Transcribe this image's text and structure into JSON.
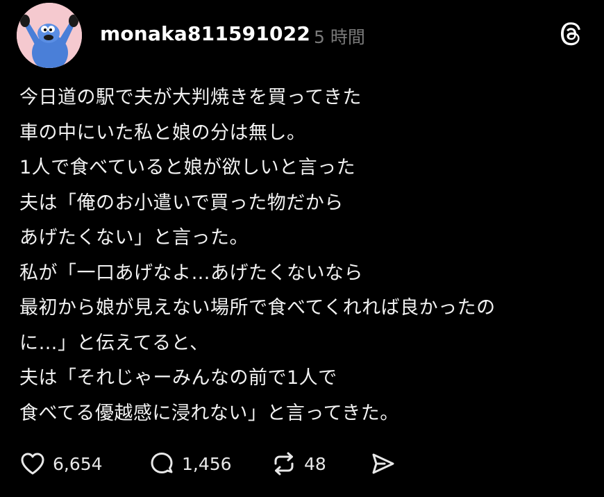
{
  "header": {
    "username": "monaka811591022",
    "timestamp": "5 時間",
    "avatar_icon": "blue-monster-avatar-icon",
    "app_logo_icon": "threads-logo-icon"
  },
  "post": {
    "lines": [
      "今日道の駅で夫が大判焼きを買ってきた",
      "車の中にいた私と娘の分は無し。",
      "1人で食べていると娘が欲しいと言った",
      "夫は「俺のお小遣いで買った物だから",
      "あげたくない」と言った。",
      "私が「一口あげなよ…あげたくないなら",
      "最初から娘が見えない場所で食べてくれれば良かったの",
      "に…」と伝えてると、",
      "夫は「それじゃーみんなの前で1人で",
      "食べてる優越感に浸れない」と言ってきた。"
    ]
  },
  "actions": {
    "like": {
      "icon": "heart-icon",
      "count": "6,654"
    },
    "comment": {
      "icon": "comment-icon",
      "count": "1,456"
    },
    "repost": {
      "icon": "repost-icon",
      "count": "48"
    },
    "share": {
      "icon": "send-icon"
    }
  },
  "colors": {
    "background": "#000000",
    "text": "#f2f2f2",
    "muted": "#7a7a7a",
    "avatar_bg": "#f5c9cf",
    "avatar_monster": "#4a7fd8"
  }
}
